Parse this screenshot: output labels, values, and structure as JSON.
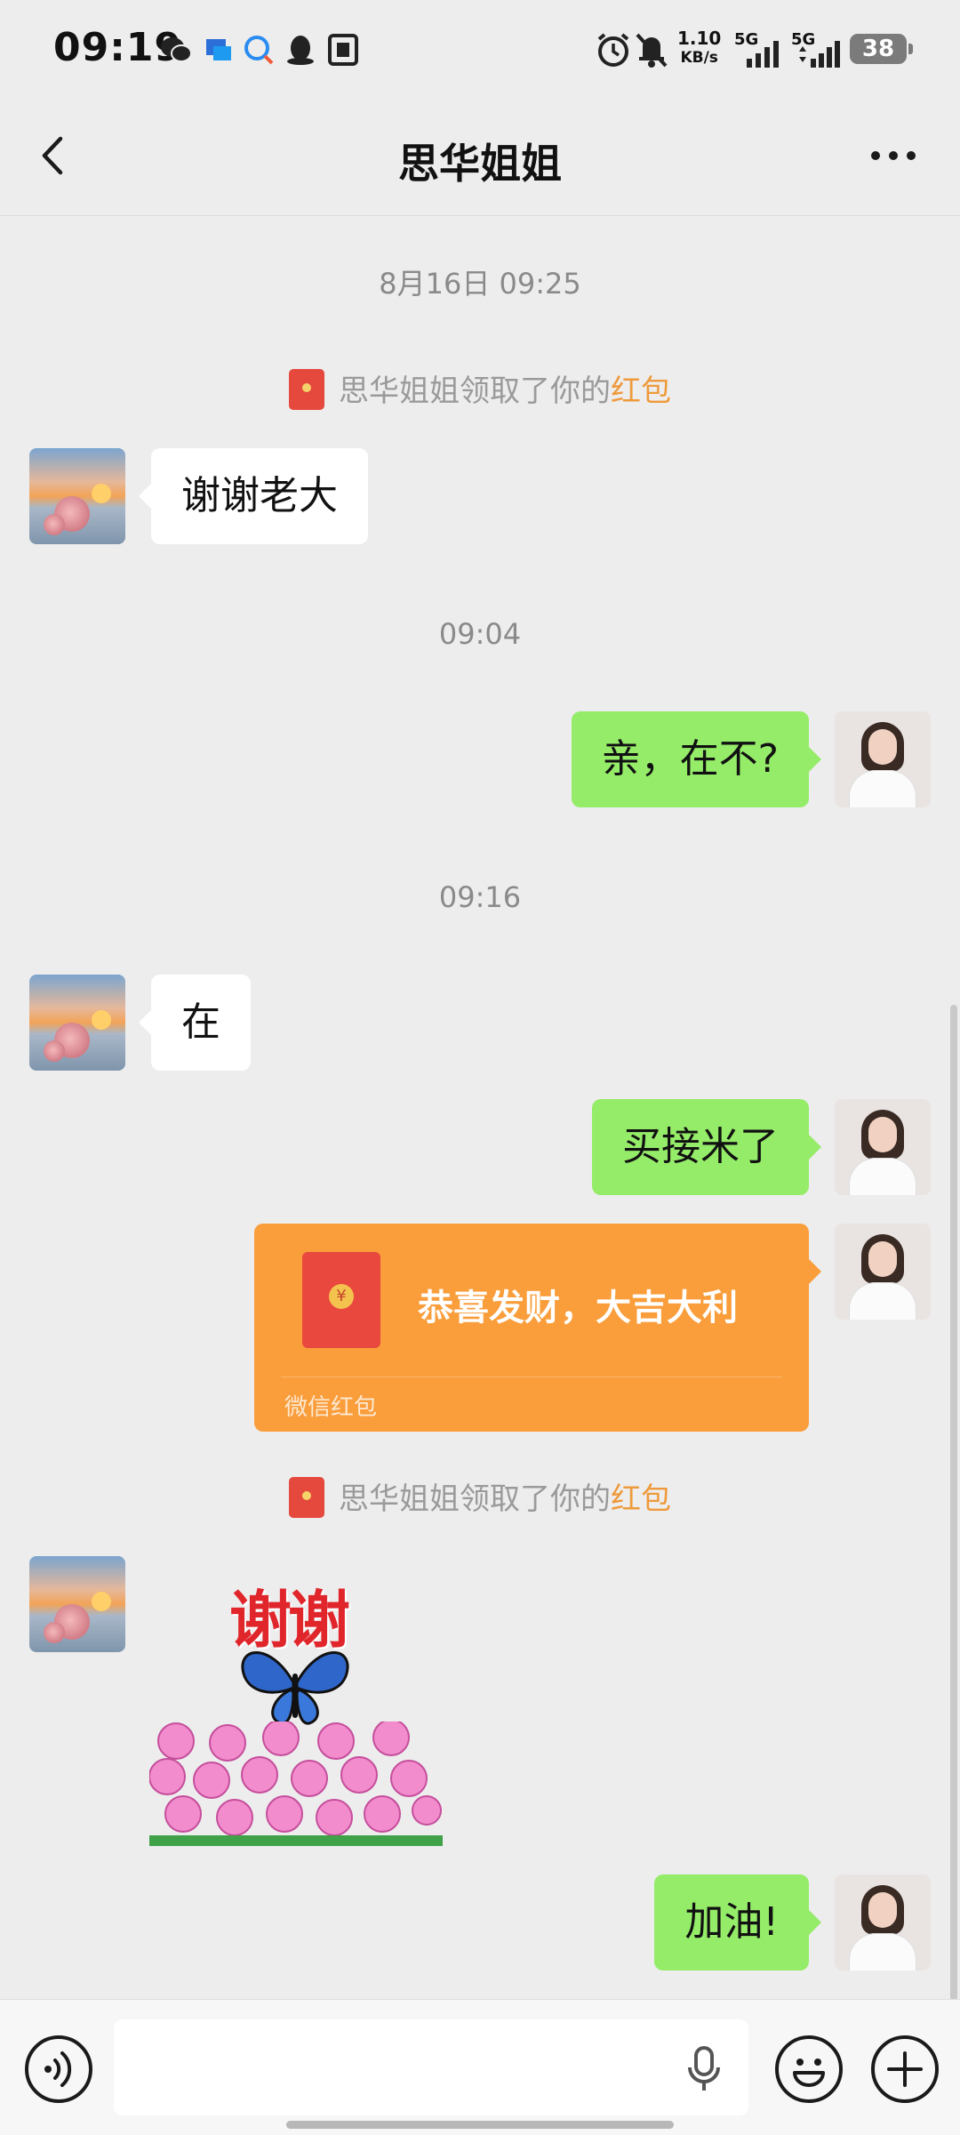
{
  "status_bar": {
    "time": "09:19",
    "net_speed_value": "1.10",
    "net_speed_unit": "KB/s",
    "signal1": "5G",
    "signal2": "5G",
    "battery": "38"
  },
  "nav": {
    "title": "思华姐姐"
  },
  "chat": {
    "time1": "8月16日 09:25",
    "sys1_prefix": "思华姐姐领取了你的",
    "sys1_link": "红包",
    "msg1": "谢谢老大",
    "time2": "09:04",
    "msg2": "亲，在不?",
    "time3": "09:16",
    "msg3": "在",
    "msg4": "买接米了",
    "redpacket_title": "恭喜发财，大吉大利",
    "redpacket_footer": "微信红包",
    "redpacket_coin": "¥",
    "sys2_prefix": "思华姐姐领取了你的",
    "sys2_link": "红包",
    "sticker_text": "谢谢",
    "msg5": "加油!"
  },
  "input": {
    "placeholder": ""
  },
  "colors": {
    "background": "#ededed",
    "sent_bubble": "#95ec69",
    "received_bubble": "#ffffff",
    "red_packet": "#fa9d3b",
    "highlight": "#ee9a3c"
  },
  "icons": {
    "back": "chevron-left-icon",
    "more": "more-dots-icon",
    "voice": "voice-icon",
    "mic": "microphone-icon",
    "emoji": "emoji-icon",
    "plus": "plus-icon"
  }
}
